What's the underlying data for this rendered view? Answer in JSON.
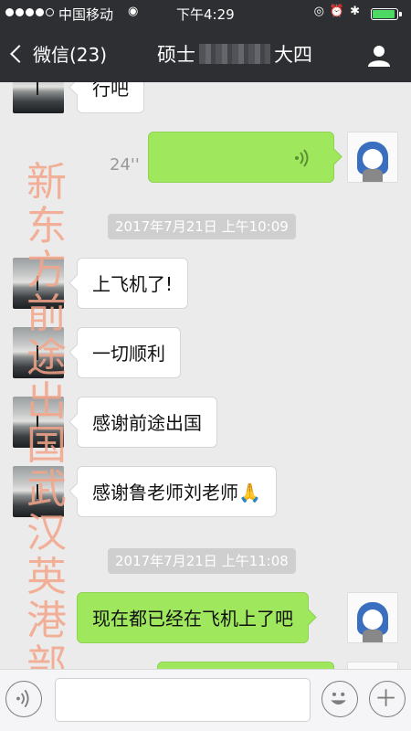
{
  "status_bar": {
    "carrier": "中国移动",
    "time": "下午4:29",
    "signal_level": 0.8,
    "battery_level": 0.85
  },
  "nav": {
    "back_label": "微信(23)",
    "title_prefix": "硕士",
    "title_suffix": "大四"
  },
  "watermark": "新东方前途出国武汉英港部",
  "messages": [
    {
      "side": "left",
      "text": "行吧"
    },
    {
      "side": "right",
      "type": "voice",
      "duration": "24''"
    },
    {
      "type": "timestamp",
      "text": "2017年7月21日 上午10:09"
    },
    {
      "side": "left",
      "text": "上飞机了!"
    },
    {
      "side": "left",
      "text": "一切顺利"
    },
    {
      "side": "left",
      "text": "感谢前途出国"
    },
    {
      "side": "left",
      "text": "感谢鲁老师刘老师🙏"
    },
    {
      "type": "timestamp",
      "text": "2017年7月21日 上午11:08"
    },
    {
      "side": "right",
      "text": "现在都已经在飞机上了吧"
    }
  ],
  "colors": {
    "bar": "#2e2f33",
    "chat_bg": "#ebebeb",
    "bubble_right": "#9fe75d",
    "bubble_left": "#ffffff",
    "watermark": "#f4a58a"
  }
}
